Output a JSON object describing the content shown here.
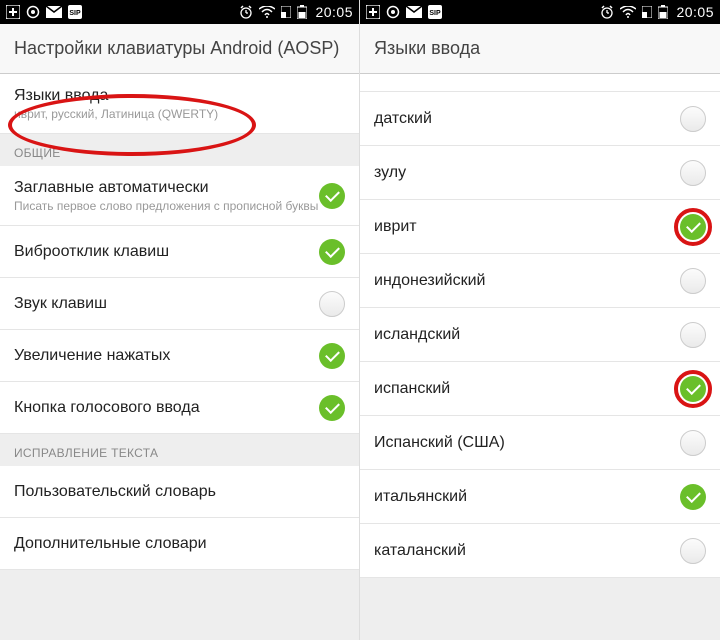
{
  "status": {
    "time": "20:05"
  },
  "left": {
    "header": "Настройки клавиатуры Android (AOSP)",
    "section_common": "ОБЩИЕ",
    "section_fix": "ИСПРАВЛЕНИЕ ТЕКСТА",
    "rows": {
      "langs": {
        "title": "Языки ввода",
        "sub": "иврит, русский, Латиница (QWERTY)"
      },
      "caps": {
        "title": "Заглавные автоматически",
        "sub": "Писать первое слово предложения с прописной буквы"
      },
      "vibro": {
        "title": "Виброотклик клавиш"
      },
      "sound": {
        "title": "Звук клавиш"
      },
      "zoom": {
        "title": "Увеличение нажатых"
      },
      "voice": {
        "title": "Кнопка голосового ввода"
      },
      "userdict": {
        "title": "Пользовательский словарь"
      },
      "extradict": {
        "title": "Дополнительные словари"
      }
    }
  },
  "right": {
    "header": "Языки ввода",
    "items": {
      "da": {
        "label": "датский",
        "on": false
      },
      "zu": {
        "label": "зулу",
        "on": false
      },
      "he": {
        "label": "иврит",
        "on": true,
        "ringed": true
      },
      "id": {
        "label": "индонезийский",
        "on": false
      },
      "is": {
        "label": "исландский",
        "on": false
      },
      "es": {
        "label": "испанский",
        "on": true,
        "ringed": true
      },
      "esus": {
        "label": "Испанский (США)",
        "on": false
      },
      "it": {
        "label": "итальянский",
        "on": true
      },
      "ca": {
        "label": "каталанский",
        "on": false
      }
    }
  }
}
